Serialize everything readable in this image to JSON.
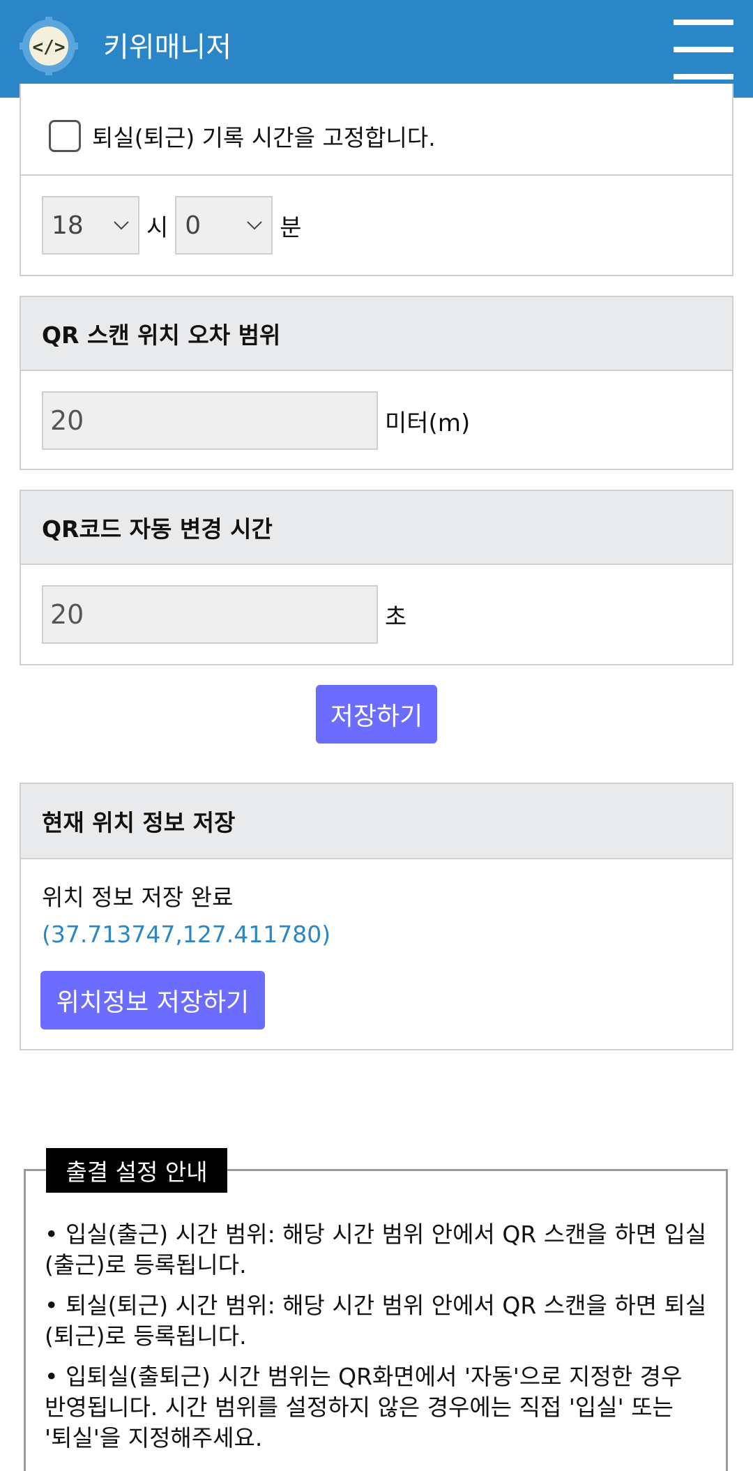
{
  "header": {
    "app_title": "키위매니저",
    "logo_icon": "code-gear-icon",
    "menu_icon": "hamburger-menu-icon"
  },
  "checkout_fix": {
    "checkbox_label": "퇴실(퇴근) 기록 시간을 고정합니다.",
    "checked": false,
    "hour_value": "18",
    "hour_unit": "시",
    "minute_value": "0",
    "minute_unit": "분"
  },
  "qr_range": {
    "title": "QR 스캔 위치 오차 범위",
    "value": "20",
    "unit": "미터(m)"
  },
  "qr_change": {
    "title": "QR코드 자동 변경 시간",
    "value": "20",
    "unit": "초"
  },
  "save_button": "저장하기",
  "location": {
    "title": "현재 위치 정보 저장",
    "status": "위치 정보 저장 완료",
    "coords": "(37.713747,127.411780)",
    "save_button": "위치정보 저장하기"
  },
  "info": {
    "title": "출결 설정 안내",
    "items": [
      "• 입실(출근) 시간 범위: 해당 시간 범위 안에서 QR 스캔을 하면 입실(출근)로 등록됩니다.",
      "• 퇴실(퇴근) 시간 범위: 해당 시간 범위 안에서 QR 스캔을 하면 퇴실(퇴근)로 등록됩니다.",
      "• 입퇴실(출퇴근) 시간 범위는 QR화면에서 '자동'으로 지정한 경우 반영됩니다. 시간 범위를 설정하지 않은 경우에는 직접 '입실' 또는 '퇴실'을 지정해주세요."
    ]
  },
  "colors": {
    "header": "#2b86c8",
    "button": "#6c6cff",
    "link": "#2b86c8"
  }
}
